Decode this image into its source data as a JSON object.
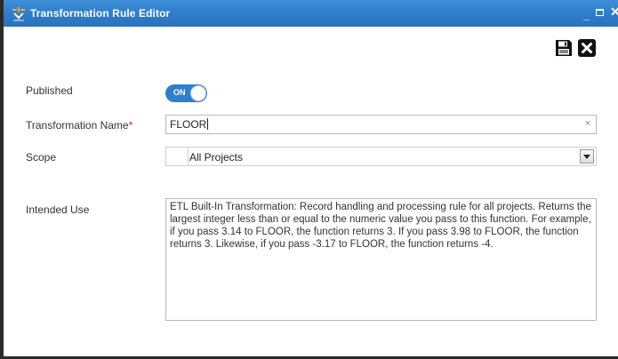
{
  "window": {
    "title": "Transformation Rule Editor",
    "icon": "transformation-app-icon",
    "minimize_glyph": "_",
    "close_glyph": "✕"
  },
  "toolbar": {
    "save_icon": "floppy-disk-icon",
    "close_icon": "close-x-icon"
  },
  "form": {
    "published": {
      "label": "Published",
      "toggle_text": "ON",
      "value": true
    },
    "transformation_name": {
      "label": "Transformation Name",
      "required_mark": "*",
      "value": "FLOOR",
      "clear_glyph": "×"
    },
    "scope": {
      "label": "Scope",
      "value": "All Projects"
    },
    "intended_use": {
      "label": "Intended Use",
      "value": "ETL Built-In Transformation: Record handling and processing rule for all projects. Returns the largest integer less than or equal to the numeric value you pass to this function. For example, if you pass 3.14 to FLOOR, the function returns 3. If you pass 3.98 to FLOOR, the function returns 3. Likewise, if you pass -3.17 to FLOOR, the function returns -4."
    }
  },
  "colors": {
    "titlebar": "#2f7dcb",
    "toggle_on": "#2d7fd1",
    "required": "#d9230f"
  }
}
